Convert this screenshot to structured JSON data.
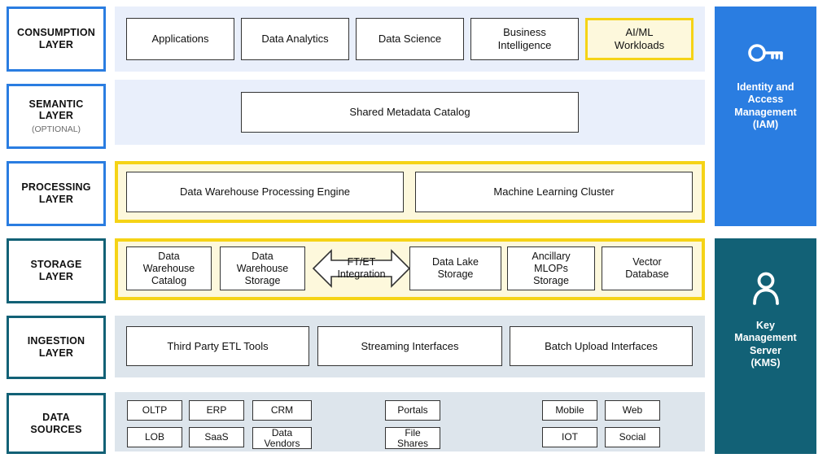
{
  "colors": {
    "blue": "#2a7de1",
    "teal": "#126176",
    "yellow": "#f5d316",
    "yellow_fill": "#fdf8dc",
    "band_light_blue": "#e9effb",
    "band_gray_blue": "#dde5ec",
    "box_border": "#333333"
  },
  "layers": [
    {
      "id": "consumption",
      "title": "CONSUMPTION\nLAYER",
      "subtitle": "",
      "border": "blue"
    },
    {
      "id": "semantic",
      "title": "SEMANTIC\nLAYER",
      "subtitle": "(OPTIONAL)",
      "border": "blue"
    },
    {
      "id": "processing",
      "title": "PROCESSING\nLAYER",
      "subtitle": "",
      "border": "blue"
    },
    {
      "id": "storage",
      "title": "STORAGE\nLAYER",
      "subtitle": "",
      "border": "teal"
    },
    {
      "id": "ingestion",
      "title": "INGESTION\nLAYER",
      "subtitle": "",
      "border": "teal"
    },
    {
      "id": "sources",
      "title": "DATA\nSOURCES",
      "subtitle": "",
      "border": "teal"
    }
  ],
  "consumption": {
    "band_color": "#e9effb",
    "items": [
      {
        "label": "Applications",
        "highlight": false
      },
      {
        "label": "Data Analytics",
        "highlight": false
      },
      {
        "label": "Data Science",
        "highlight": false
      },
      {
        "label": "Business\nIntelligence",
        "highlight": false
      },
      {
        "label": "AI/ML\nWorkloads",
        "highlight": true
      }
    ]
  },
  "semantic": {
    "band_color": "#e9effb",
    "items": [
      {
        "label": "Shared Metadata Catalog"
      }
    ]
  },
  "processing": {
    "band_color": "#fdf8dc",
    "band_border": "#f5d316",
    "items": [
      {
        "label": "Data Warehouse Processing Engine"
      },
      {
        "label": "Machine Learning Cluster"
      }
    ]
  },
  "storage": {
    "band_color": "#fdf8dc",
    "band_border": "#f5d316",
    "items": [
      {
        "label": "Data\nWarehouse\nCatalog"
      },
      {
        "label": "Data\nWarehouse\nStorage"
      },
      {
        "label": "Data Lake\nStorage"
      },
      {
        "label": "Ancillary\nMLOPs\nStorage"
      },
      {
        "label": "Vector\nDatabase"
      }
    ],
    "integration_arrow": {
      "label": "FT/ET\nIntegration",
      "direction": "bidirectional"
    }
  },
  "ingestion": {
    "band_color": "#dde5ec",
    "items": [
      {
        "label": "Third Party ETL Tools"
      },
      {
        "label": "Streaming Interfaces"
      },
      {
        "label": "Batch Upload Interfaces"
      }
    ]
  },
  "sources": {
    "band_color": "#dde5ec",
    "groups": [
      {
        "id": "enterprise",
        "rows": [
          [
            "OLTP",
            "ERP",
            "CRM"
          ],
          [
            "LOB",
            "SaaS",
            "Data\nVendors"
          ]
        ]
      },
      {
        "id": "content",
        "rows": [
          [
            "Portals"
          ],
          [
            "File\nShares"
          ]
        ]
      },
      {
        "id": "channels",
        "rows": [
          [
            "Mobile",
            "Web"
          ],
          [
            "IOT",
            "Social"
          ]
        ]
      }
    ]
  },
  "side_panels": [
    {
      "id": "iam",
      "icon": "key-icon",
      "title": "Identity and\nAccess\nManagement\n(IAM)",
      "color": "#2a7de1"
    },
    {
      "id": "kms",
      "icon": "user-icon",
      "title": "Key\nManagement\nServer\n(KMS)",
      "color": "#126176"
    }
  ]
}
